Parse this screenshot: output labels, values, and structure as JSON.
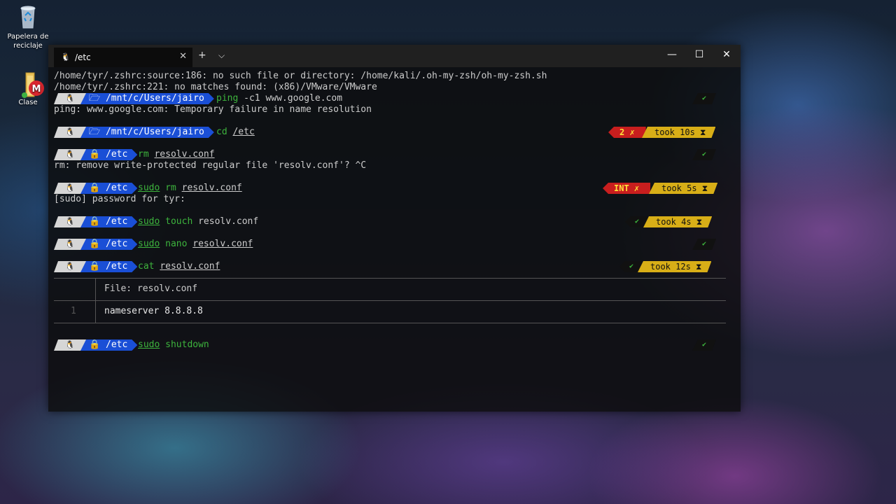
{
  "desktop": {
    "icons": [
      {
        "label": "Papelera de reciclaje",
        "icon": "recycle-bin-icon"
      },
      {
        "label": "Clase",
        "icon": "mega-folder-icon"
      }
    ]
  },
  "window": {
    "tab_title": "/etc",
    "tab_icon": "tux-icon",
    "new_tab": "+",
    "dropdown": "⌵",
    "close_tab": "✕",
    "min": "—",
    "max": "☐",
    "close": "✕"
  },
  "terminal": {
    "lines": [
      "/home/tyr/.zshrc:source:186: no such file or directory: /home/kali/.oh-my-zsh/oh-my-zsh.sh",
      "/home/tyr/.zshrc:221: no matches found: (x86)/VMware/VMware",
      "ping: www.google.com: Temporary failure in name resolution",
      "rm: remove write-protected regular file 'resolv.conf'? ^C",
      "[sudo] password for tyr:"
    ],
    "os_glyph": "🐧",
    "dir_icon_folder": "🗁",
    "dir_icon_lock": "🔒",
    "prompts": [
      {
        "dir": "/mnt/c/Users/jairo",
        "cmd1": "ping",
        "cmd2": " -c1 www.google.com",
        "ok": "✔"
      },
      {
        "dir": "/mnt/c/Users/jairo",
        "cmd1": "cd",
        "cmd2": "/etc",
        "err": "2 ✗",
        "took": "took 10s ⧗"
      },
      {
        "dir": "/etc",
        "cmd1": "rm",
        "cmd2": "resolv.conf",
        "ok": "✔"
      },
      {
        "dir": "/etc",
        "cmd1": "sudo",
        "cmd1b": "rm",
        "cmd2": "resolv.conf",
        "err": "INT ✗",
        "took": "took 5s ⧗"
      },
      {
        "dir": "/etc",
        "cmd1": "sudo",
        "cmd1b": "touch",
        "cmd2": "resolv.conf",
        "ok": "✔",
        "took": "took 4s ⧗"
      },
      {
        "dir": "/etc",
        "cmd1": "sudo",
        "cmd1b": "nano",
        "cmd2": "resolv.conf",
        "ok": "✔"
      },
      {
        "dir": "/etc",
        "cmd1": "cat",
        "cmd2": "resolv.conf",
        "ok": "✔",
        "took": "took 12s ⧗"
      },
      {
        "dir": "/etc",
        "cmd1": "sudo",
        "cmd1b": "shutdown",
        "ok": "✔"
      }
    ],
    "bat": {
      "file_label": "File: ",
      "file_name": "resolv.conf",
      "line_no": "1",
      "content": "nameserver 8.8.8.8"
    }
  }
}
